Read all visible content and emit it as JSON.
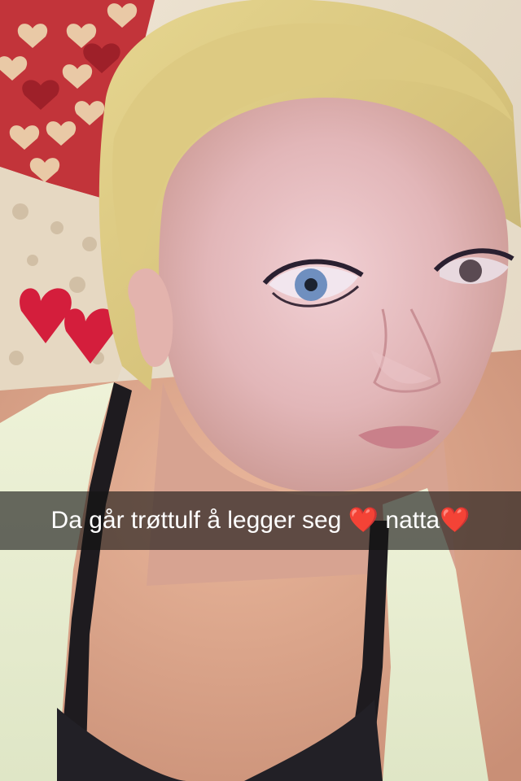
{
  "snap": {
    "caption": "Da går trøttulf å legger seg ❤️  natta❤️"
  },
  "photo": {
    "subject": "selfie",
    "background_pattern": "hearts"
  }
}
